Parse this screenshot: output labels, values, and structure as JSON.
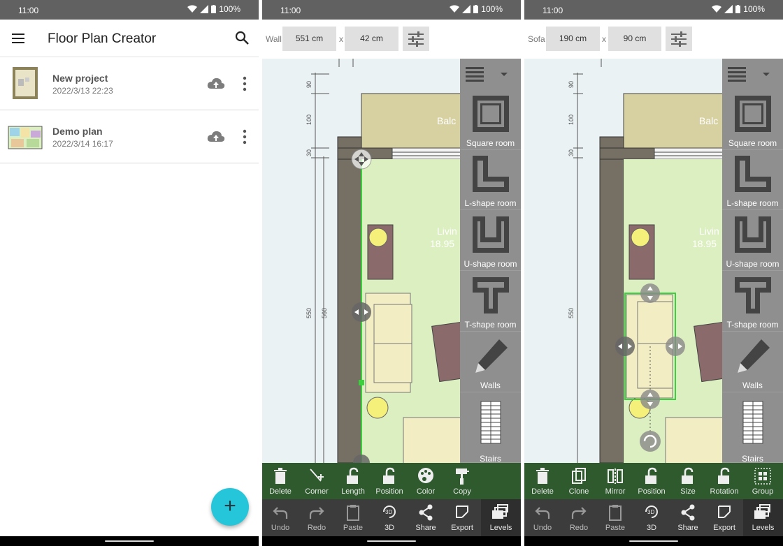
{
  "status": {
    "time": "11:00",
    "battery": "100%"
  },
  "screen1": {
    "app_title": "Floor Plan Creator",
    "projects": [
      {
        "name": "New project",
        "date": "2022/3/13 22:23"
      },
      {
        "name": "Demo plan",
        "date": "2022/3/14 16:17"
      }
    ],
    "fab_label": "+"
  },
  "screen2": {
    "toolbar": {
      "label": "Wall",
      "length": "551 cm",
      "x": "x",
      "thickness": "42 cm"
    },
    "canvas": {
      "balcony": "Balc",
      "living": "Livin",
      "area": "18.95",
      "dims": [
        "90",
        "100",
        "30",
        "550",
        "560"
      ]
    },
    "palette": [
      "Square room",
      "L-shape room",
      "U-shape room",
      "T-shape room",
      "Walls",
      "Stairs"
    ],
    "actions": [
      "Delete",
      "Corner",
      "Length",
      "Position",
      "Color",
      "Copy"
    ],
    "nav": [
      "Undo",
      "Redo",
      "Paste",
      "3D",
      "Share",
      "Export",
      "Levels"
    ]
  },
  "screen3": {
    "toolbar": {
      "label": "Sofa",
      "length": "190 cm",
      "x": "x",
      "width": "90 cm"
    },
    "canvas": {
      "balcony": "Balc",
      "living": "Livin",
      "area": "18.95",
      "dims": [
        "90",
        "100",
        "30",
        "550"
      ]
    },
    "palette": [
      "Square room",
      "L-shape room",
      "U-shape room",
      "T-shape room",
      "Walls",
      "Stairs"
    ],
    "actions": [
      "Delete",
      "Clone",
      "Mirror",
      "Position",
      "Size",
      "Rotation",
      "Group"
    ],
    "nav": [
      "Undo",
      "Redo",
      "Paste",
      "3D",
      "Share",
      "Export",
      "Levels"
    ]
  },
  "colors": {
    "accent": "#26c6da",
    "action_bar": "#2e5a2e",
    "nav_bar": "#3c3c3c",
    "palette": "#8f8f8f",
    "room_floor": "#dcefc0",
    "selection": "#3ecf3e"
  },
  "icons": {
    "menu": "hamburger-icon",
    "search": "search-icon",
    "cloud": "cloud-upload-icon",
    "more": "more-vert-icon"
  }
}
